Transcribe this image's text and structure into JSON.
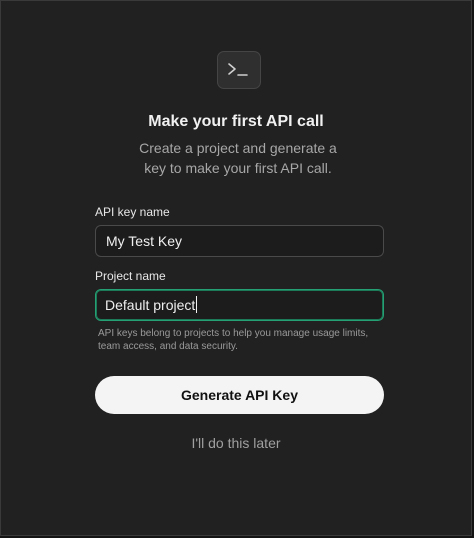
{
  "modal": {
    "icon": "terminal-icon",
    "title": "Make your first API call",
    "subtitle": "Create a project and generate a key to make your first API call."
  },
  "form": {
    "api_key_label": "API key name",
    "api_key_value": "My Test Key",
    "project_label": "Project name",
    "project_value": "Default project",
    "hint": "API keys belong to projects to help you manage usage limits, team access, and data security."
  },
  "actions": {
    "generate_label": "Generate API Key",
    "later_label": "I'll do this later"
  },
  "colors": {
    "background": "#212121",
    "focus_border": "#25a074",
    "button_background": "#f4f4f4"
  }
}
